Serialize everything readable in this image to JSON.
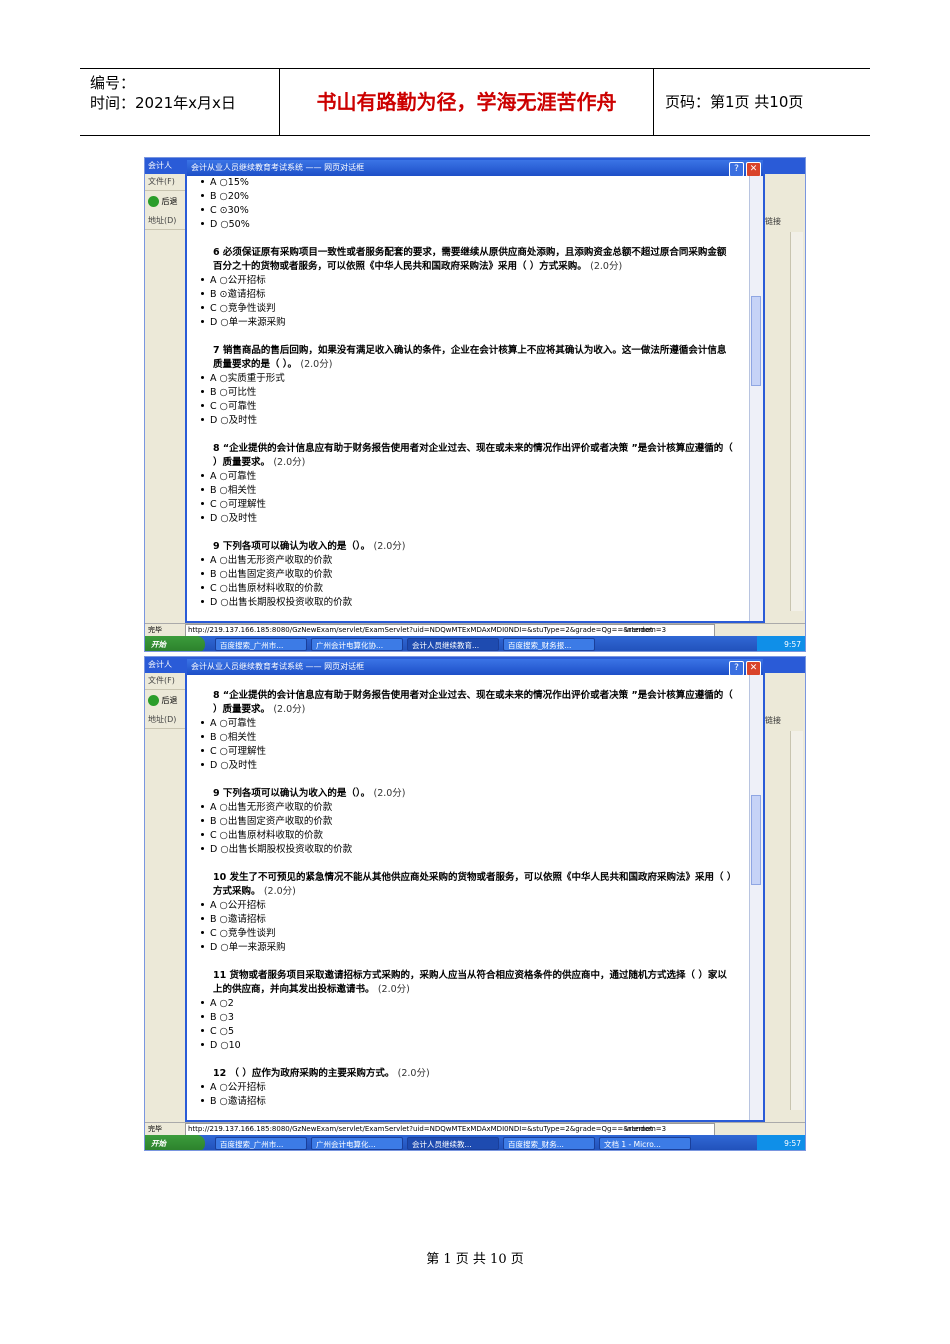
{
  "header": {
    "code_label": "编号：",
    "time_label": "时间：2021年x月x日",
    "motto": "书山有路勤为径，学海无涯苦作舟",
    "page_label": "页码：第1页  共10页"
  },
  "footer": {
    "text": "第 1 页 共 10 页"
  },
  "screens": [
    {
      "bg_title": "会计人",
      "dialog_title": "会计从业人员继续教育考试系统 —— 网页对话框",
      "menu_file": "文件(F)",
      "back": "后退",
      "address": "地址(D)",
      "links": "链接",
      "questions": [
        {
          "title": "",
          "points": "",
          "options": [
            "A ○15%",
            "B ○20%",
            "C ⊙30%",
            "D ○50%"
          ],
          "selected": 2
        },
        {
          "title": "6 必须保证原有采购项目一致性或者服务配套的要求，需要继续从原供应商处添购，且添购资金总额不超过原合同采购金额百分之十的货物或者服务，可以依照《中华人民共和国政府采购法》采用（ ）方式采购。",
          "points": "(2.0分)",
          "options": [
            "A ○公开招标",
            "B ⊙邀请招标",
            "C ○竞争性谈判",
            "D ○单一来源采购"
          ],
          "selected": 1
        },
        {
          "title": "7 销售商品的售后回购，如果没有满足收入确认的条件，企业在会计核算上不应将其确认为收入。这一做法所遵循会计信息质量要求的是（ ）。",
          "points": "(2.0分)",
          "options": [
            "A ○实质重于形式",
            "B ○可比性",
            "C ○可靠性",
            "D ○及时性"
          ],
          "selected": -1
        },
        {
          "title": "8 “企业提供的会计信息应有助于财务报告使用者对企业过去、现在或未来的情况作出评价或者决策 ”是会计核算应遵循的（ ）质量要求。",
          "points": "(2.0分)",
          "options": [
            "A ○可靠性",
            "B ○相关性",
            "C ○可理解性",
            "D ○及时性"
          ],
          "selected": -1
        },
        {
          "title": "9 下列各项可以确认为收入的是（）。",
          "points": "(2.0分)",
          "options": [
            "A ○出售无形资产收取的价款",
            "B ○出售固定资产收取的价款",
            "C ○出售原材料收取的价款",
            "D ○出售长期股权投资收取的价款"
          ],
          "selected": -1
        }
      ],
      "status_done": "完毕",
      "url": "http://219.137.166.185:8080/GzNewExam/servlet/ExamServlet?uid=NDQwMTExMDAxMDI0NDI=&stuType=2&grade=Qg==&random=3",
      "zone": "Internet",
      "start": "开始",
      "tasks": [
        "百度搜索_广州市...",
        "广州会计电算化协...",
        "会计人员继续教育...",
        "百度搜索_财务报..."
      ],
      "clock": "9:57"
    },
    {
      "bg_title": "会计人",
      "dialog_title": "会计从业人员继续教育考试系统 —— 网页对话框",
      "menu_file": "文件(F)",
      "back": "后退",
      "address": "地址(D)",
      "links": "链接",
      "questions": [
        {
          "title": "8 “企业提供的会计信息应有助于财务报告使用者对企业过去、现在或未来的情况作出评价或者决策 ”是会计核算应遵循的（ ）质量要求。",
          "points": "(2.0分)",
          "options": [
            "A ○可靠性",
            "B ○相关性",
            "C ○可理解性",
            "D ○及时性"
          ],
          "selected": -1
        },
        {
          "title": "9 下列各项可以确认为收入的是（）。",
          "points": "(2.0分)",
          "options": [
            "A ○出售无形资产收取的价款",
            "B ○出售固定资产收取的价款",
            "C ○出售原材料收取的价款",
            "D ○出售长期股权投资收取的价款"
          ],
          "selected": -1
        },
        {
          "title": "10 发生了不可预见的紧急情况不能从其他供应商处采购的货物或者服务，可以依照《中华人民共和国政府采购法》采用（ ）方式采购。",
          "points": "(2.0分)",
          "options": [
            "A ○公开招标",
            "B ○邀请招标",
            "C ○竞争性谈判",
            "D ○单一来源采购"
          ],
          "selected": -1
        },
        {
          "title": "11 货物或者服务项目采取邀请招标方式采购的，采购人应当从符合相应资格条件的供应商中，通过随机方式选择（ ）家以上的供应商，并向其发出投标邀请书。",
          "points": "(2.0分)",
          "options": [
            "A ○2",
            "B ○3",
            "C ○5",
            "D ○10"
          ],
          "selected": -1
        },
        {
          "title": "12 （ ）应作为政府采购的主要采购方式。",
          "points": "(2.0分)",
          "options": [
            "A ○公开招标",
            "B ○邀请招标"
          ],
          "selected": -1
        }
      ],
      "status_done": "完毕",
      "url": "http://219.137.166.185:8080/GzNewExam/servlet/ExamServlet?uid=NDQwMTExMDAxMDI0NDI=&stuType=2&grade=Qg==&random=3",
      "zone": "Internet",
      "start": "开始",
      "tasks": [
        "百度搜索_广州市...",
        "广州会计电算化...",
        "会计人员继续教...",
        "百度搜索_财务...",
        "文档 1 - Micro..."
      ],
      "clock": "9:57"
    }
  ]
}
